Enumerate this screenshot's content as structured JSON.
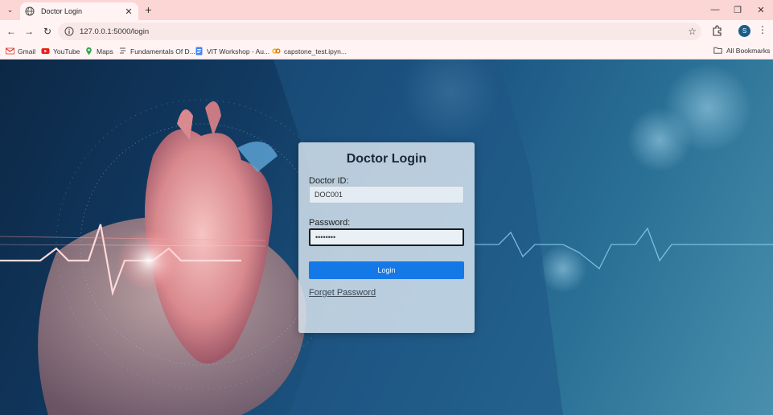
{
  "browser": {
    "tab_title": "Doctor Login",
    "url": "127.0.0.1:5000/login",
    "avatar_letter": "S",
    "bookmarks": [
      {
        "label": "Gmail",
        "icon": "gmail-icon"
      },
      {
        "label": "YouTube",
        "icon": "youtube-icon"
      },
      {
        "label": "Maps",
        "icon": "maps-icon"
      },
      {
        "label": "Fundamentals Of D...",
        "icon": "fundamentals-icon"
      },
      {
        "label": "VIT Workshop - Au...",
        "icon": "docs-icon"
      },
      {
        "label": "capstone_test.ipyn...",
        "icon": "colab-icon"
      }
    ],
    "all_bookmarks_label": "All Bookmarks"
  },
  "login": {
    "title": "Doctor Login",
    "doctor_id_label": "Doctor ID:",
    "doctor_id_value": "DOC001",
    "password_label": "Password:",
    "password_value": "••••••••",
    "login_button": "Login",
    "forgot_password": "Forget Password"
  },
  "colors": {
    "tabbar": "#fbd6d4",
    "toolbar": "#fff4f3",
    "login_button": "#1479e6",
    "card": "#dce8f2"
  }
}
